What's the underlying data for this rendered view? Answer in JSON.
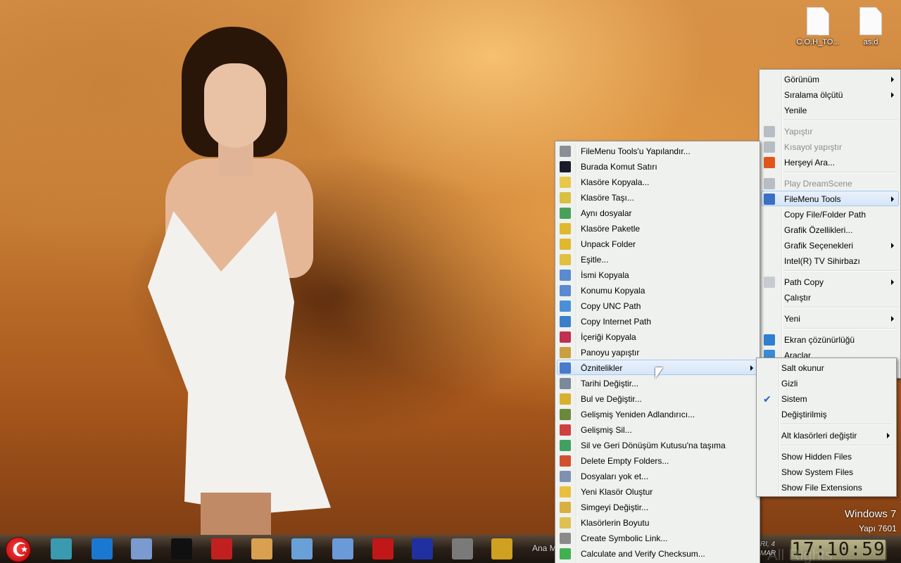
{
  "desktop": {
    "icons": [
      {
        "label": "C.O.H_TO...",
        "icon": "shortcut-file-icon"
      },
      {
        "label": "as.d",
        "icon": "file-icon"
      }
    ]
  },
  "context_menu": {
    "items": [
      {
        "label": "Görünüm",
        "submenu": true
      },
      {
        "label": "Sıralama ölçütü",
        "submenu": true
      },
      {
        "label": "Yenile"
      },
      {
        "sep": true
      },
      {
        "label": "Yapıştır",
        "disabled": true,
        "icon": "paste-icon",
        "color": "#b8bcc4"
      },
      {
        "label": "Kısayol yapıştır",
        "disabled": true,
        "icon": "paste-shortcut-icon",
        "color": "#b8bcc4"
      },
      {
        "label": "Herşeyi Ara...",
        "icon": "search-everything-icon",
        "color": "#e0561a"
      },
      {
        "sep": true
      },
      {
        "label": "Play DreamScene",
        "disabled": true,
        "icon": "dreamscene-icon",
        "color": "#b8bcc4"
      },
      {
        "label": "FileMenu Tools",
        "submenu": true,
        "highlighted": true,
        "icon": "filemenu-tools-icon",
        "color": "#3a6fc4"
      },
      {
        "label": "Copy File/Folder Path"
      },
      {
        "label": "Grafik Özellikleri..."
      },
      {
        "label": "Grafik Seçenekleri",
        "submenu": true
      },
      {
        "label": "Intel(R) TV Sihirbazı"
      },
      {
        "sep": true
      },
      {
        "label": "Path Copy",
        "submenu": true,
        "icon": "path-copy-icon",
        "color": "#c8ccd2"
      },
      {
        "label": "Çalıştır"
      },
      {
        "sep": true
      },
      {
        "label": "Yeni",
        "submenu": true
      },
      {
        "sep": true
      },
      {
        "label": "Ekran çözünürlüğü",
        "icon": "screen-resolution-icon",
        "color": "#2f7fd0"
      },
      {
        "label": "Araclar",
        "icon": "tools-icon",
        "color": "#3a8ad8"
      }
    ]
  },
  "filemenu_tools": {
    "items": [
      {
        "label": "FileMenu Tools'u Yapılandır...",
        "icon": "configure-tools-icon",
        "color": "#8a8f96"
      },
      {
        "label": "Burada Komut Satırı",
        "icon": "command-prompt-icon",
        "color": "#1a1a2a"
      },
      {
        "label": "Klasöre Kopyala...",
        "icon": "copy-to-folder-icon",
        "color": "#e8c84a"
      },
      {
        "label": "Klasöre Taşı...",
        "icon": "move-to-folder-icon",
        "color": "#d8c040"
      },
      {
        "label": "Aynı dosyalar",
        "icon": "same-files-icon",
        "color": "#4aa05a"
      },
      {
        "label": "Klasöre Paketle",
        "icon": "pack-folder-icon",
        "color": "#e0b830"
      },
      {
        "label": "Unpack Folder",
        "icon": "unpack-folder-icon",
        "color": "#e0b830"
      },
      {
        "label": "Eşitle...",
        "icon": "synchronize-icon",
        "color": "#e0c040"
      },
      {
        "label": "İsmi Kopyala",
        "icon": "copy-name-icon",
        "color": "#5a8ad0"
      },
      {
        "label": "Konumu Kopyala",
        "icon": "copy-location-icon",
        "color": "#5a8ad0"
      },
      {
        "label": "Copy UNC Path",
        "icon": "copy-unc-path-icon",
        "color": "#4a90d8"
      },
      {
        "label": "Copy Internet Path",
        "icon": "copy-internet-path-icon",
        "color": "#3a80c8"
      },
      {
        "label": "İçeriği Kopyala",
        "icon": "copy-content-icon",
        "color": "#c03050"
      },
      {
        "label": "Panoyu yapıştır",
        "icon": "paste-clipboard-icon",
        "color": "#c8a040"
      },
      {
        "label": "Öznitelikler",
        "submenu": true,
        "highlighted": true,
        "icon": "attributes-icon",
        "color": "#4a7ac8"
      },
      {
        "label": "Tarihi Değiştir...",
        "icon": "change-date-icon",
        "color": "#7a8a9a"
      },
      {
        "label": "Bul ve Değiştir...",
        "icon": "find-replace-icon",
        "color": "#d8b030"
      },
      {
        "label": "Gelişmiş Yeniden Adlandırıcı...",
        "icon": "advanced-renamer-icon",
        "color": "#6a8a3a"
      },
      {
        "label": "Gelişmiş Sil...",
        "icon": "advanced-delete-icon",
        "color": "#d04040"
      },
      {
        "label": "Sil ve Geri Dönüşüm Kutusu'na taşıma",
        "icon": "delete-no-recycle-icon",
        "color": "#40a060"
      },
      {
        "label": "Delete Empty Folders...",
        "icon": "delete-empty-folders-icon",
        "color": "#d05030"
      },
      {
        "label": "Dosyaları yok et...",
        "icon": "shred-files-icon",
        "color": "#8090b0"
      },
      {
        "label": "Yeni Klasör Oluştur",
        "icon": "new-folder-icon",
        "color": "#e8c040"
      },
      {
        "label": "Simgeyi Değiştir...",
        "icon": "change-icon-icon",
        "color": "#d8b040"
      },
      {
        "label": "Klasörlerin Boyutu",
        "icon": "folder-size-icon",
        "color": "#e0c050"
      },
      {
        "label": "Create Symbolic Link...",
        "icon": "symbolic-link-icon",
        "color": "#8a8a8a"
      },
      {
        "label": "Calculate and Verify Checksum...",
        "icon": "checksum-icon",
        "color": "#40b050"
      }
    ]
  },
  "attributes_menu": {
    "items": [
      {
        "label": "Salt okunur"
      },
      {
        "label": "Gizli"
      },
      {
        "label": "Sistem",
        "checked": true
      },
      {
        "label": "Değiştirilmiş"
      },
      {
        "sep": true
      },
      {
        "label": "Alt klasörleri değiştir",
        "submenu": true
      },
      {
        "sep": true
      },
      {
        "label": "Show Hidden Files"
      },
      {
        "label": "Show System Files"
      },
      {
        "label": "Show File Extensions"
      }
    ]
  },
  "watermark": {
    "os": "Windows 7",
    "build": "Yapı 7601",
    "copyright": "All Rights Reserved"
  },
  "taskbar": {
    "items": [
      {
        "icon": "firewire-icon",
        "color": "#3a9ab0"
      },
      {
        "icon": "windows-icon",
        "color": "#1a78d0"
      },
      {
        "icon": "control-panel-icon",
        "color": "#7a9ad0"
      },
      {
        "icon": "command-prompt-icon",
        "color": "#101010"
      },
      {
        "icon": "registry-icon",
        "color": "#c02020"
      },
      {
        "icon": "notes-icon",
        "color": "#d8a050"
      },
      {
        "icon": "notepad-icon",
        "color": "#6aa0d8"
      },
      {
        "icon": "documents-icon",
        "color": "#6a9ad8"
      },
      {
        "icon": "shf-game-icon",
        "color": "#c01818"
      },
      {
        "icon": "battleship-icon",
        "color": "#2030a0"
      },
      {
        "icon": "captain-hat-icon",
        "color": "#7a7a7a"
      },
      {
        "icon": "weather-icon",
        "color": "#d0a020"
      }
    ],
    "partial_label": "Ana M",
    "date_line1": "RI, 4",
    "date_line2": "MAR",
    "clock": "17:10:59"
  }
}
